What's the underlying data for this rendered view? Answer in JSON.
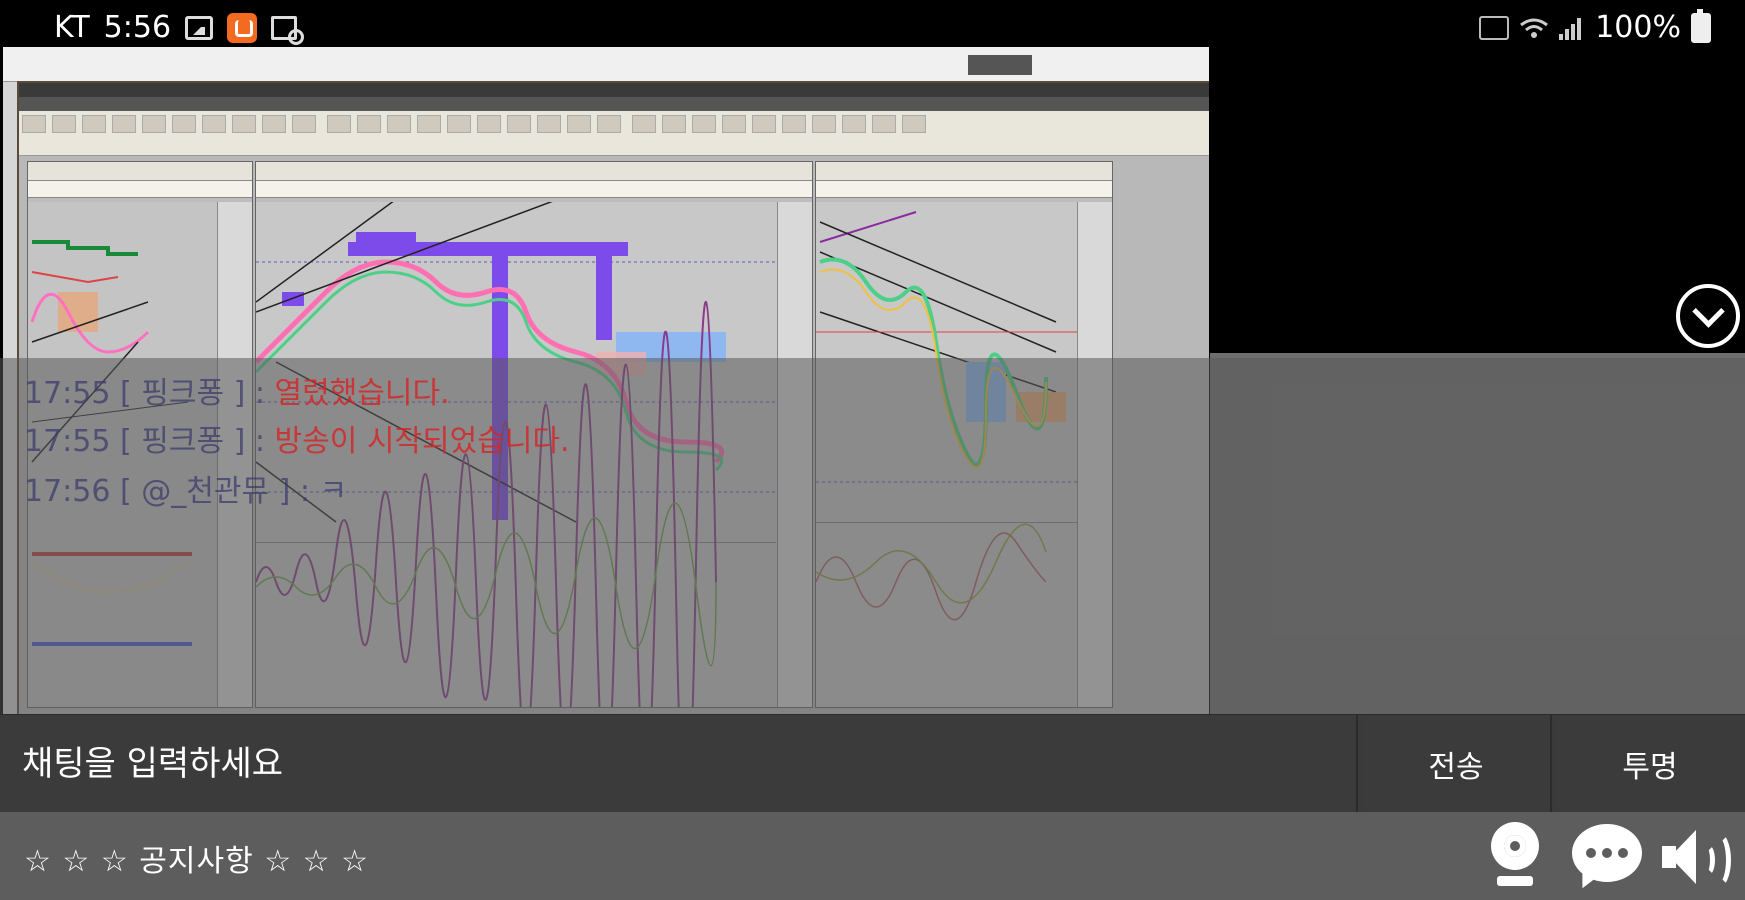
{
  "status_bar": {
    "carrier": "KT",
    "time": "5:56",
    "battery": "100%",
    "icons": [
      "image-icon",
      "app-icon",
      "image-search-icon",
      "vibrate-icon",
      "wifi-icon",
      "signal-icon",
      "battery-icon"
    ]
  },
  "chat_overlay": {
    "lines": [
      {
        "time": "17:55",
        "user": "[ 핑크퐁 ] :",
        "message": "열렸했습니다."
      },
      {
        "time": "17:55",
        "user": "[ 핑크퐁 ] :",
        "message": "방송이 시작되었습니다."
      },
      {
        "time": "17:56",
        "user": "[ @_천관뮤 ] :",
        "message": "ㅋ"
      }
    ]
  },
  "input_bar": {
    "placeholder": "채팅을 입력하세요",
    "send_label": "전송",
    "transparent_label": "투명"
  },
  "notice_bar": {
    "text": "☆ ☆ ☆ 공지사항 ☆ ☆ ☆"
  },
  "colors": {
    "background": "#000000",
    "input_bar": "#3b3b3b",
    "notice_bar": "#5d5d5d",
    "chat_message": "#d22828",
    "app_icon": "#f36b21"
  }
}
